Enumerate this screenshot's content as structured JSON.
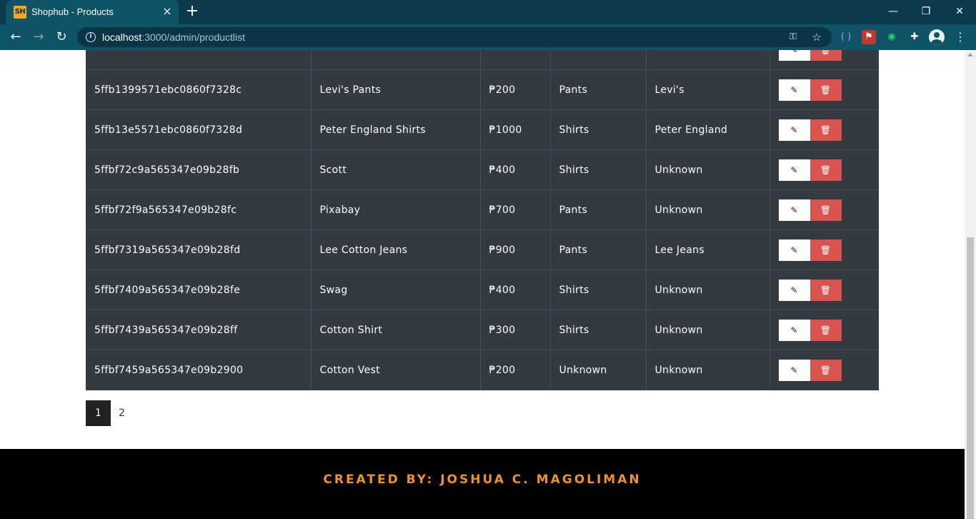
{
  "browser": {
    "tab_title": "Shophub - Products",
    "favicon_text": "SH",
    "url_host": "localhost",
    "url_path": ":3000/admin/productlist",
    "minimize": "—",
    "restore": "❐",
    "close": "✕"
  },
  "table": {
    "rows": [
      {
        "id": "5ffb1399571ebc0860f7328c",
        "name": "Levi's Pants",
        "price": "₱200",
        "category": "Pants",
        "brand": "Levi's"
      },
      {
        "id": "5ffb13e5571ebc0860f7328d",
        "name": "Peter England Shirts",
        "price": "₱1000",
        "category": "Shirts",
        "brand": "Peter England"
      },
      {
        "id": "5ffbf72c9a565347e09b28fb",
        "name": "Scott",
        "price": "₱400",
        "category": "Shirts",
        "brand": "Unknown"
      },
      {
        "id": "5ffbf72f9a565347e09b28fc",
        "name": "Pixabay",
        "price": "₱700",
        "category": "Pants",
        "brand": "Unknown"
      },
      {
        "id": "5ffbf7319a565347e09b28fd",
        "name": "Lee Cotton Jeans",
        "price": "₱900",
        "category": "Pants",
        "brand": "Lee Jeans"
      },
      {
        "id": "5ffbf7409a565347e09b28fe",
        "name": "Swag",
        "price": "₱400",
        "category": "Shirts",
        "brand": "Unknown"
      },
      {
        "id": "5ffbf7439a565347e09b28ff",
        "name": "Cotton Shirt",
        "price": "₱300",
        "category": "Shirts",
        "brand": "Unknown"
      },
      {
        "id": "5ffbf7459a565347e09b2900",
        "name": "Cotton Vest",
        "price": "₱200",
        "category": "Unknown",
        "brand": "Unknown"
      }
    ],
    "edit_icon": "edit-icon",
    "delete_icon": "trash-icon"
  },
  "pagination": {
    "pages": [
      "1",
      "2"
    ],
    "active_page": "1"
  },
  "footer": {
    "text": "CREATED BY: JOSHUA C. MAGOLIMAN"
  },
  "colors": {
    "table_bg": "#343a40",
    "delete_btn": "#d9534f",
    "footer_text": "#f4921f",
    "chrome_bg": "#0f5366"
  }
}
